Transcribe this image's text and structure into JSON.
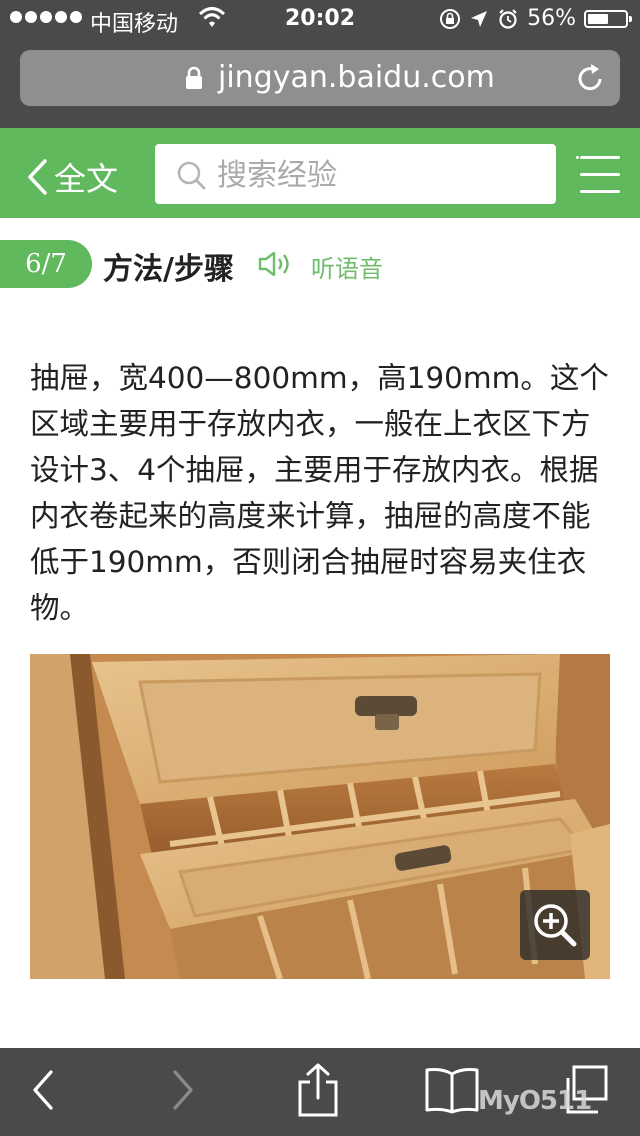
{
  "status_bar": {
    "carrier": "中国移动",
    "time": "20:02",
    "battery_percent_text": "56%",
    "battery_level": 0.56
  },
  "browser": {
    "url": "jingyan.baidu.com"
  },
  "header": {
    "back_label": "全文",
    "search_placeholder": "搜索经验"
  },
  "step": {
    "badge": "6/7",
    "title": "方法/步骤",
    "listen_label": "听语音"
  },
  "content": {
    "paragraph": "抽屉，宽400—800mm，高190mm。这个区域主要用于存放内衣，一般在上衣区下方设计3、4个抽屉，主要用于存放内衣。根据内衣卷起来的高度来计算，抽屉的高度不能低于190mm，否则闭合抽屉时容易夹住衣物。"
  },
  "watermark": "MyO511"
}
